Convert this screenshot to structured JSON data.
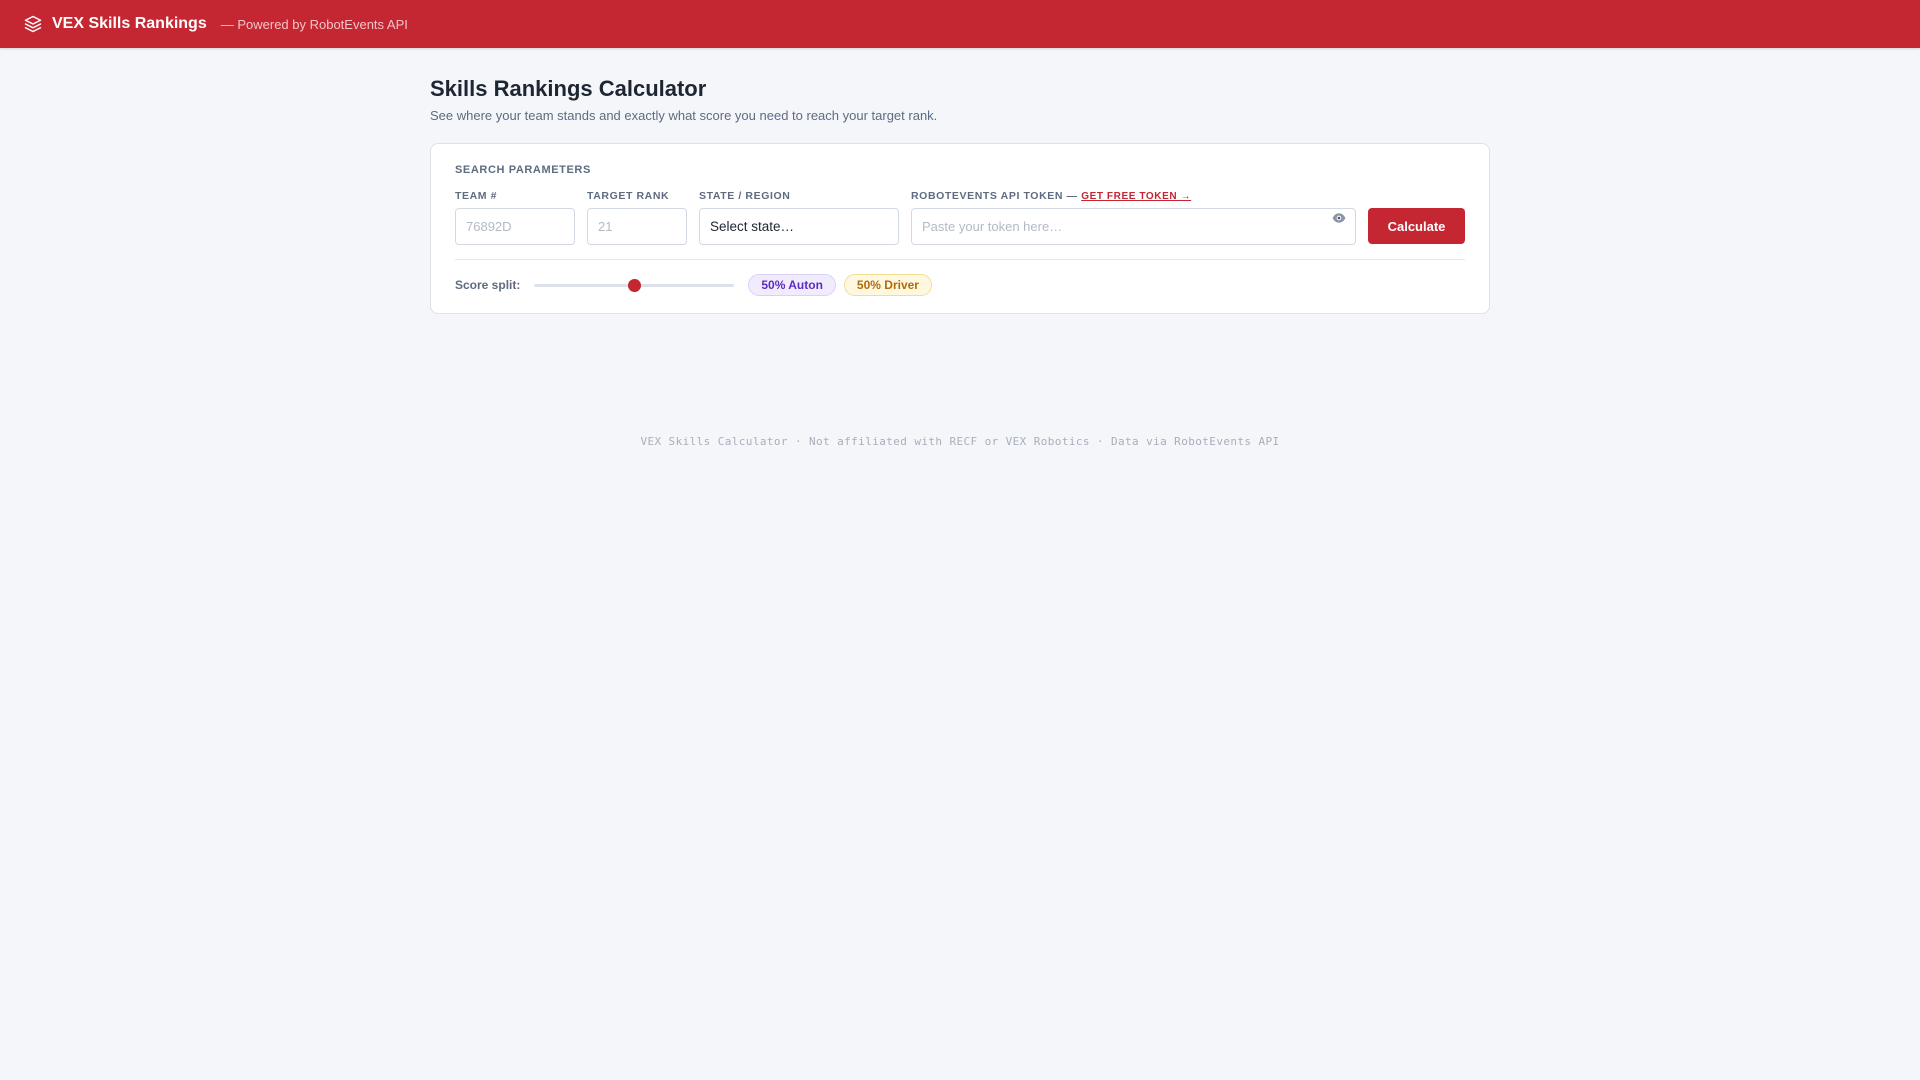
{
  "header": {
    "brand": "VEX Skills Rankings",
    "powered": "— Powered by RobotEvents API",
    "logo_icon": "layers-icon"
  },
  "main": {
    "title": "Skills Rankings Calculator",
    "subtitle": "See where your team stands and exactly what score you need to reach your target rank."
  },
  "search": {
    "section_label": "Search Parameters",
    "team": {
      "label": "Team #",
      "placeholder": "76892D",
      "value": ""
    },
    "target_rank": {
      "label": "Target Rank",
      "placeholder": "21",
      "value": ""
    },
    "state": {
      "label": "State / Region",
      "selected": "Select state…"
    },
    "token": {
      "label": "RoboTEvents API Token —",
      "link_text": "Get free token →",
      "placeholder": "Paste your token here…",
      "value": "",
      "toggle_icon": "eye-icon"
    },
    "calculate_label": "Calculate"
  },
  "split": {
    "label": "Score split:",
    "auton_percent": 50,
    "auton_label": "50% Auton",
    "driver_label": "50% Driver"
  },
  "footer": {
    "text": "VEX Skills Calculator · Not affiliated with RECF or VEX Robotics · Data via RobotEvents API"
  },
  "colors": {
    "brand": "#c42632",
    "background": "#f4f6fa",
    "auton": "#5b2bc2",
    "driver": "#b46a06"
  }
}
